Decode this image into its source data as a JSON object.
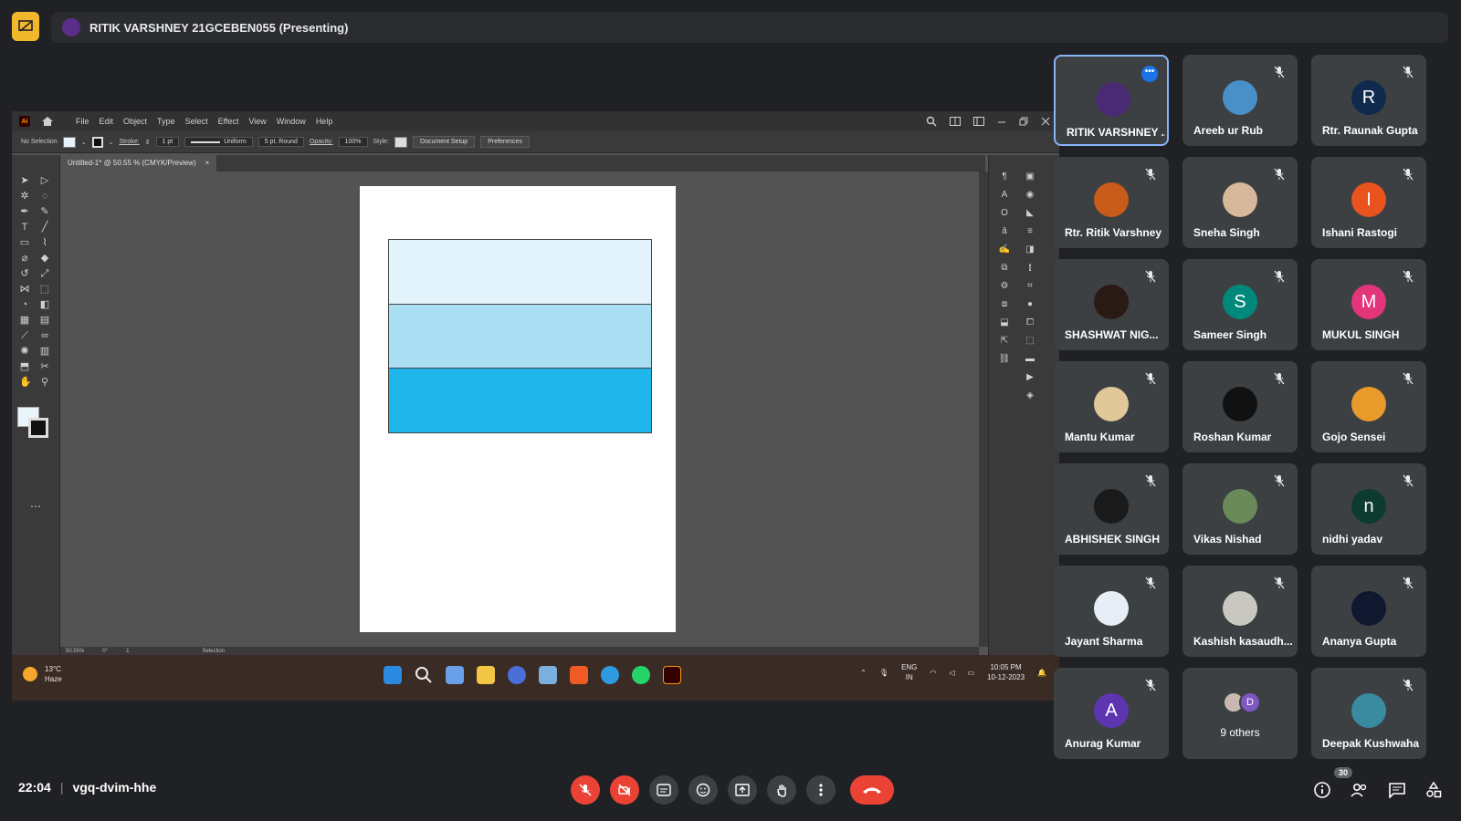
{
  "presenter": {
    "label": "RITIK VARSHNEY 21GCEBEN055 (Presenting)"
  },
  "illustrator": {
    "menu": [
      "File",
      "Edit",
      "Object",
      "Type",
      "Select",
      "Effect",
      "View",
      "Window",
      "Help"
    ],
    "control": {
      "selection": "No Selection",
      "stroke_label": "Stroke:",
      "stroke_value": "1 pt",
      "profile": "Uniform",
      "brush": "5 pt. Round",
      "opacity_label": "Opacity:",
      "opacity_value": "100%",
      "style_label": "Style:",
      "doc_setup": "Document Setup",
      "preferences": "Preferences"
    },
    "tab": {
      "title": "Untitled-1* @ 50.55 % (CMYK/Preview)",
      "close": "×"
    },
    "artboard_fills": [
      "#e2f3fb",
      "#aadef3",
      "#1fb6ec"
    ],
    "status": {
      "zoom": "50.55%",
      "rotate": "0°",
      "artboard": "1",
      "tool": "Selection"
    }
  },
  "taskbar": {
    "temp": "13°C",
    "condition": "Haze",
    "lang": "ENG",
    "region": "IN",
    "time": "10:05 PM",
    "date": "10-12-2023"
  },
  "participants": [
    {
      "name": "RITIK VARSHNEY ...",
      "color": "#4a2a72",
      "initial": "",
      "active": true
    },
    {
      "name": "Areeb ur Rub",
      "color": "#4a90c8",
      "initial": ""
    },
    {
      "name": "Rtr. Raunak Gupta",
      "color": "#0f2a4d",
      "initial": "R"
    },
    {
      "name": "Rtr. Ritik Varshney",
      "color": "#c85a1a",
      "initial": ""
    },
    {
      "name": "Sneha Singh",
      "color": "#d8b89a",
      "initial": ""
    },
    {
      "name": "Ishani Rastogi",
      "color": "#e8531e",
      "initial": "I"
    },
    {
      "name": "SHASHWAT NIG...",
      "color": "#2a1a14",
      "initial": ""
    },
    {
      "name": "Sameer Singh",
      "color": "#00897b",
      "initial": "S"
    },
    {
      "name": "MUKUL SINGH",
      "color": "#e2357a",
      "initial": "M"
    },
    {
      "name": "Mantu Kumar",
      "color": "#e0c89a",
      "initial": ""
    },
    {
      "name": "Roshan Kumar",
      "color": "#111111",
      "initial": ""
    },
    {
      "name": "Gojo Sensei",
      "color": "#e89a2a",
      "initial": ""
    },
    {
      "name": "ABHISHEK SINGH",
      "color": "#1a1a1a",
      "initial": ""
    },
    {
      "name": "Vikas Nishad",
      "color": "#6a8a5a",
      "initial": ""
    },
    {
      "name": "nidhi yadav",
      "color": "#0d3b30",
      "initial": "n"
    },
    {
      "name": "Jayant Sharma",
      "color": "#e8eef6",
      "initial": ""
    },
    {
      "name": "Kashish kasaudh...",
      "color": "#c8c8c0",
      "initial": ""
    },
    {
      "name": "Ananya Gupta",
      "color": "#101830",
      "initial": ""
    },
    {
      "name": "Anurag Kumar",
      "color": "#5e35b1",
      "initial": "A"
    },
    {
      "name": "9 others",
      "color": "#7e57c2",
      "initial": "D",
      "others": true
    },
    {
      "name": "Deepak Kushwaha",
      "color": "#3a8aa0",
      "initial": ""
    }
  ],
  "meeting": {
    "time": "22:04",
    "separator": "|",
    "code": "vgq-dvim-hhe",
    "people_count": "30"
  }
}
